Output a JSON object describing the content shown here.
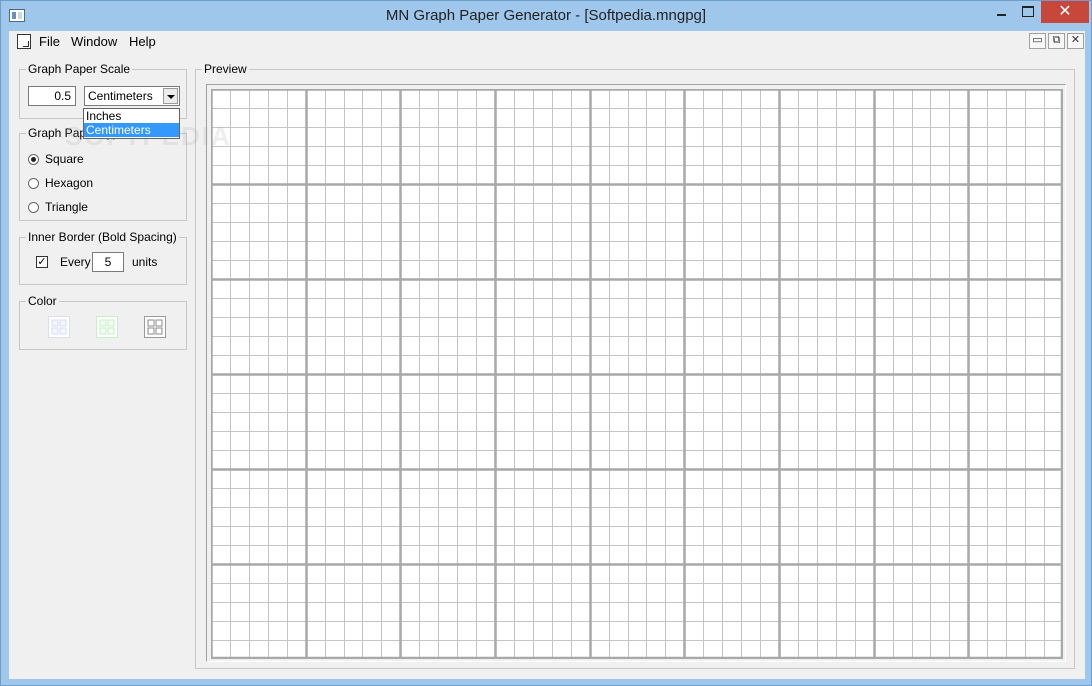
{
  "window": {
    "title": "MN Graph Paper Generator - [Softpedia.mngpg]",
    "close_glyph": "✕"
  },
  "menubar": {
    "items": [
      "File",
      "Window",
      "Help"
    ],
    "mdi_buttons": [
      "▭",
      "⧉",
      "✕"
    ]
  },
  "scale": {
    "legend": "Graph Paper Scale",
    "value": "0.5",
    "unit_selected": "Centimeters",
    "unit_options": [
      "Inches",
      "Centimeters"
    ],
    "highlighted_option": "Centimeters"
  },
  "paper_type": {
    "legend": "Graph Paper Type",
    "options": [
      "Square",
      "Hexagon",
      "Triangle"
    ],
    "selected": "Square"
  },
  "inner_border": {
    "legend": "Inner Border (Bold Spacing)",
    "checked": true,
    "check_glyph": "✓",
    "every_label": "Every",
    "value": "5",
    "units_label": "units"
  },
  "color": {
    "legend": "Color",
    "swatches": [
      {
        "name": "background-color",
        "color": "#d8dcf6"
      },
      {
        "name": "minor-line-color",
        "color": "#c6eec6"
      },
      {
        "name": "major-line-color",
        "color": "#9a9a9a"
      }
    ]
  },
  "preview": {
    "legend": "Preview",
    "cols": 45,
    "rows": 30,
    "bold_every": 5,
    "minor_color": "#c4c4c4",
    "major_color": "#a8a8a8"
  },
  "watermark": "SOFTPEDIA"
}
